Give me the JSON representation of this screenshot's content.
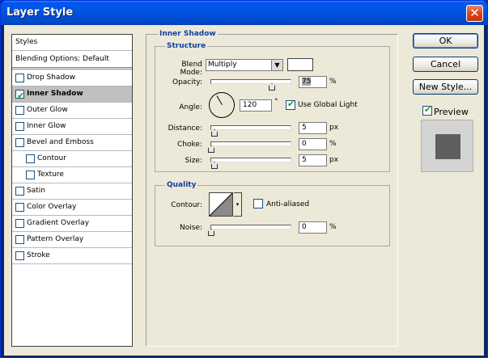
{
  "window": {
    "title": "Layer Style",
    "close_glyph": "✕"
  },
  "sidebar": {
    "header": "Styles",
    "blending": "Blending Options: Default",
    "items": [
      {
        "label": "Drop Shadow",
        "checked": false,
        "indent": false
      },
      {
        "label": "Inner Shadow",
        "checked": true,
        "indent": false,
        "selected": true
      },
      {
        "label": "Outer Glow",
        "checked": false,
        "indent": false
      },
      {
        "label": "Inner Glow",
        "checked": false,
        "indent": false
      },
      {
        "label": "Bevel and Emboss",
        "checked": false,
        "indent": false
      },
      {
        "label": "Contour",
        "checked": false,
        "indent": true
      },
      {
        "label": "Texture",
        "checked": false,
        "indent": true
      },
      {
        "label": "Satin",
        "checked": false,
        "indent": false
      },
      {
        "label": "Color Overlay",
        "checked": false,
        "indent": false
      },
      {
        "label": "Gradient Overlay",
        "checked": false,
        "indent": false
      },
      {
        "label": "Pattern Overlay",
        "checked": false,
        "indent": false
      },
      {
        "label": "Stroke",
        "checked": false,
        "indent": false
      }
    ]
  },
  "panel": {
    "title": "Inner Shadow",
    "structure": {
      "legend": "Structure",
      "blend_mode_label": "Blend Mode:",
      "blend_mode_value": "Multiply",
      "opacity_label": "Opacity:",
      "opacity_value": "75",
      "opacity_level": 0.75,
      "angle_label": "Angle:",
      "angle_value": "120",
      "degree_symbol": "°",
      "use_global_light_label": "Use Global Light",
      "use_global_light": true,
      "distance_label": "Distance:",
      "distance_value": "5",
      "choke_label": "Choke:",
      "choke_value": "0",
      "size_label": "Size:",
      "size_value": "5",
      "unit_px": "px",
      "unit_pct": "%"
    },
    "quality": {
      "legend": "Quality",
      "contour_label": "Contour:",
      "anti_aliased_label": "Anti-aliased",
      "anti_aliased": false,
      "noise_label": "Noise:",
      "noise_value": "0",
      "unit_pct": "%"
    }
  },
  "buttons": {
    "ok": "OK",
    "cancel": "Cancel",
    "new_style": "New Style...",
    "preview": "Preview",
    "preview_checked": true
  },
  "icons": {
    "checkmark": "✔",
    "dropdown": "▼",
    "small_dropdown": "▾"
  }
}
